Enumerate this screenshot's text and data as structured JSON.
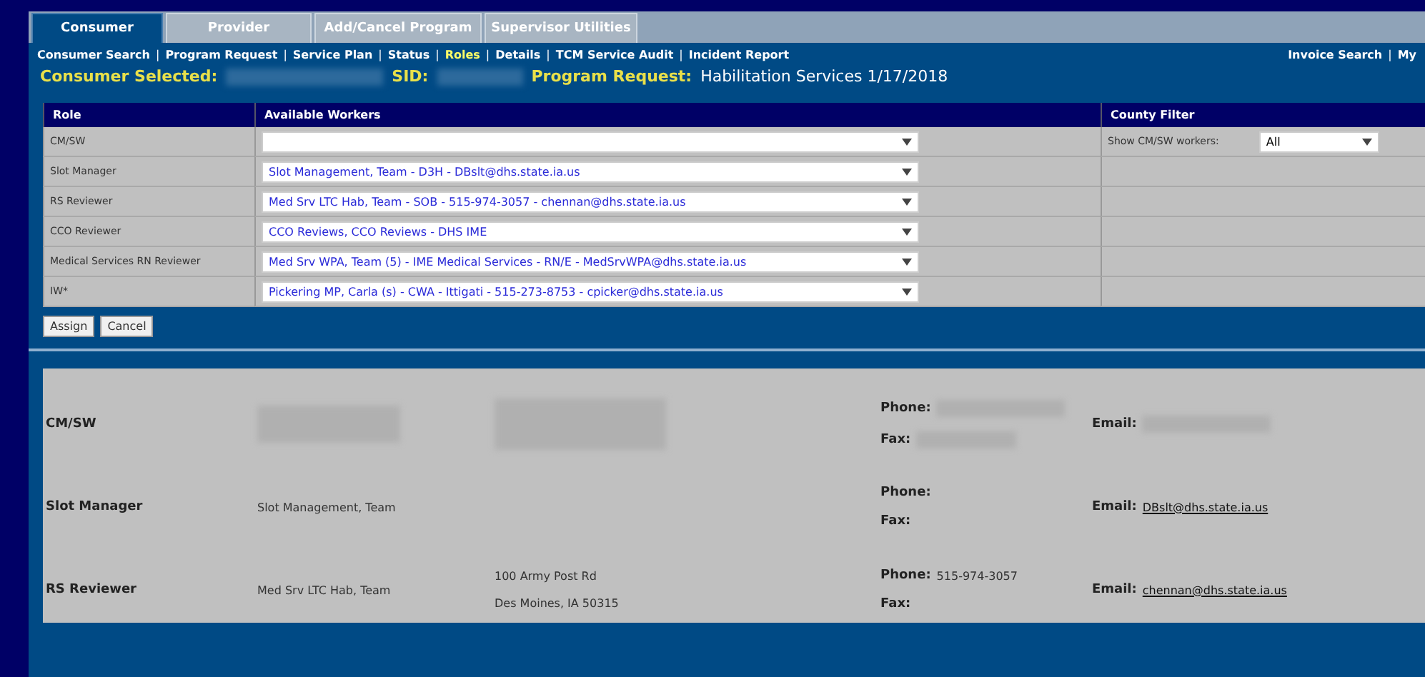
{
  "tabs": [
    {
      "label": "Consumer",
      "selected": true
    },
    {
      "label": "Provider",
      "selected": false
    },
    {
      "label": "Add/Cancel Program",
      "selected": false
    },
    {
      "label": "Supervisor Utilities",
      "selected": false
    }
  ],
  "subnav": {
    "links": [
      {
        "label": "Consumer Search",
        "selected": false
      },
      {
        "label": "Program Request",
        "selected": false
      },
      {
        "label": "Service Plan",
        "selected": false
      },
      {
        "label": "Status",
        "selected": false
      },
      {
        "label": "Roles",
        "selected": true
      },
      {
        "label": "Details",
        "selected": false
      },
      {
        "label": "TCM Service Audit",
        "selected": false
      },
      {
        "label": "Incident Report",
        "selected": false
      }
    ],
    "right_links": [
      "Invoice Search",
      "My"
    ],
    "separator": "|"
  },
  "info": {
    "consumer_label": "Consumer Selected:",
    "sid_label": "SID:",
    "program_label": "Program Request:",
    "program_value": "Habilitation Services 1/17/2018"
  },
  "roles_table": {
    "columns": [
      "Role",
      "Available Workers",
      "County Filter"
    ],
    "rows": [
      {
        "role": "CM/SW",
        "worker": ""
      },
      {
        "role": "Slot Manager",
        "worker": "Slot Management, Team - D3H - DBslt@dhs.state.ia.us"
      },
      {
        "role": "RS Reviewer",
        "worker": "Med Srv LTC Hab, Team - SOB - 515-974-3057 - chennan@dhs.state.ia.us"
      },
      {
        "role": "CCO Reviewer",
        "worker": "CCO Reviews, CCO Reviews - DHS IME"
      },
      {
        "role": "Medical Services RN Reviewer",
        "worker": "Med Srv WPA, Team (5) - IME Medical Services - RN/E - MedSrvWPA@dhs.state.ia.us"
      },
      {
        "role": "IW*",
        "worker": "Pickering MP, Carla (s) - CWA - Ittigati - 515-273-8753 - cpicker@dhs.state.ia.us"
      }
    ],
    "county_filter": {
      "label": "Show CM/SW workers:",
      "value": "All"
    }
  },
  "buttons": [
    "Assign",
    "Cancel"
  ],
  "details": [
    {
      "role": "CM/SW",
      "redacted": true,
      "phone_label": "Phone:",
      "fax_label": "Fax:",
      "email_label": "Email:"
    },
    {
      "role": "Slot Manager",
      "redacted": false,
      "name": "Slot Management, Team",
      "phone_label": "Phone:",
      "fax_label": "Fax:",
      "email_label": "Email:",
      "email": "DBslt@dhs.state.ia.us"
    },
    {
      "role": "RS Reviewer",
      "redacted": false,
      "name": "Med Srv LTC Hab, Team",
      "address": [
        "100 Army Post Rd",
        "Des Moines, IA 50315"
      ],
      "phone_label": "Phone:",
      "phone": "515-974-3057",
      "fax_label": "Fax:",
      "email_label": "Email:",
      "email": "chennan@dhs.state.ia.us"
    }
  ]
}
